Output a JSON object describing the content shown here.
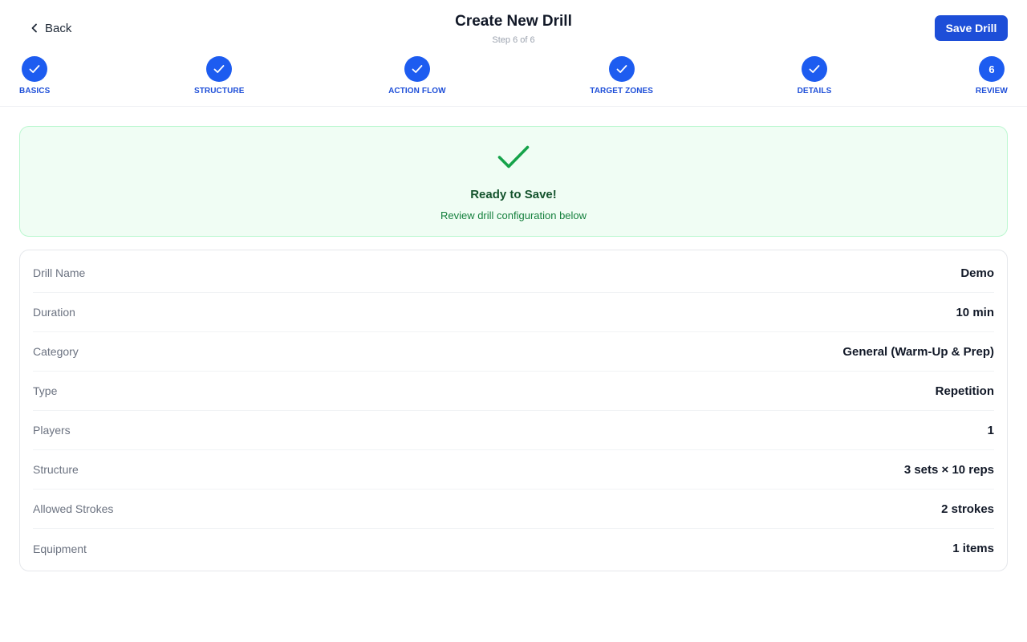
{
  "header": {
    "back_label": "Back",
    "title": "Create New Drill",
    "step_text": "Step 6 of 6",
    "save_label": "Save Drill"
  },
  "steps": [
    {
      "label": "BASICS",
      "status": "complete"
    },
    {
      "label": "STRUCTURE",
      "status": "complete"
    },
    {
      "label": "ACTION FLOW",
      "status": "complete"
    },
    {
      "label": "TARGET ZONES",
      "status": "complete"
    },
    {
      "label": "DETAILS",
      "status": "complete"
    },
    {
      "label": "REVIEW",
      "status": "current",
      "number": "6"
    }
  ],
  "ready": {
    "icon": "check-icon",
    "title": "Ready to Save!",
    "subtitle": "Review drill configuration below"
  },
  "summary": [
    {
      "label": "Drill Name",
      "value": "Demo"
    },
    {
      "label": "Duration",
      "value": "10 min"
    },
    {
      "label": "Category",
      "value": "General (Warm-Up & Prep)"
    },
    {
      "label": "Type",
      "value": "Repetition"
    },
    {
      "label": "Players",
      "value": "1"
    },
    {
      "label": "Structure",
      "value": "3 sets × 10 reps"
    },
    {
      "label": "Allowed Strokes",
      "value": "2 strokes"
    },
    {
      "label": "Equipment",
      "value": "1 items"
    }
  ],
  "colors": {
    "primary": "#1d4ed8",
    "step_circle": "#1d5cf0",
    "success_bg": "#f0fdf4",
    "success_border": "#bbf7d0",
    "success_icon": "#16a34a"
  }
}
